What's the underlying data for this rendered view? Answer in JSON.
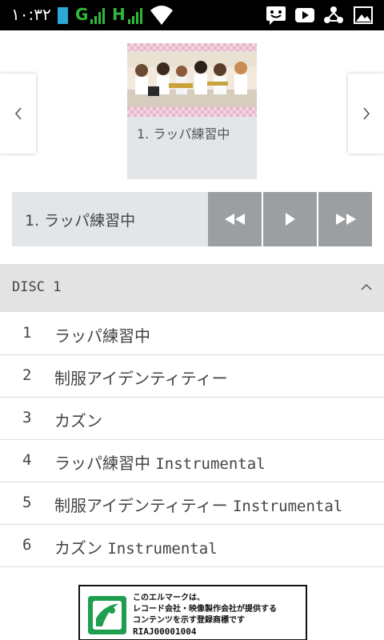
{
  "status_bar": {
    "time": "١٠:٣٢",
    "network_1": "G",
    "network_2": "H",
    "icons": [
      "battery-icon",
      "signal-icon",
      "signal-icon",
      "wifi-icon",
      "messenger-icon",
      "youtube-icon",
      "recycle-icon",
      "image-icon"
    ]
  },
  "carousel": {
    "album_title": "1. ラッパ練習中",
    "prev_icon": "chevron-left-icon",
    "next_icon": "chevron-right-icon"
  },
  "player": {
    "now_playing": "1. ラッパ練習中",
    "controls": [
      "rewind-icon",
      "play-icon",
      "fast-forward-icon"
    ]
  },
  "disc": {
    "label": "DISC 1",
    "chevron_icon": "chevron-up-icon"
  },
  "tracks": [
    {
      "num": "1",
      "title": "ラッパ練習中",
      "suffix": ""
    },
    {
      "num": "2",
      "title": "制服アイデンティティー",
      "suffix": ""
    },
    {
      "num": "3",
      "title": "カズン",
      "suffix": ""
    },
    {
      "num": "4",
      "title": "ラッパ練習中 ",
      "suffix": "Instrumental"
    },
    {
      "num": "5",
      "title": "制服アイデンティティー ",
      "suffix": "Instrumental"
    },
    {
      "num": "6",
      "title": "カズン ",
      "suffix": "Instrumental"
    }
  ],
  "lmark": {
    "line1": "このエルマークは、",
    "line2": "レコード会社・映像製作会社が提供する",
    "line3": "コンテンツを示す登録商標です",
    "code": "RIAJ00001004"
  },
  "colors": {
    "status_bg": "#000000",
    "signal_green": "#31b83a",
    "battery_blue": "#2aa9d6",
    "panel_grey": "#e3e6e9",
    "control_grey": "#9b9fa2",
    "lmark_green": "#1f9e4f"
  }
}
